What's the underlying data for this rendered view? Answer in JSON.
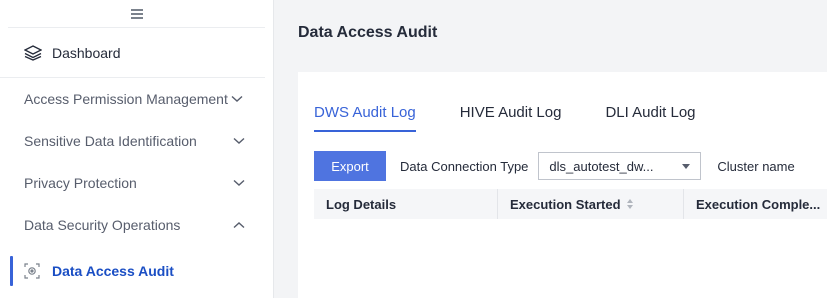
{
  "sidebar": {
    "dashboard_label": "Dashboard",
    "items": [
      {
        "label": "Access Permission Management",
        "chevron": "down"
      },
      {
        "label": "Sensitive Data Identification",
        "chevron": "down"
      },
      {
        "label": "Privacy Protection",
        "chevron": "down"
      },
      {
        "label": "Data Security Operations",
        "chevron": "up"
      }
    ],
    "active_sub_item": "Data Access Audit"
  },
  "main": {
    "title": "Data Access Audit",
    "tabs": [
      {
        "label": "DWS Audit Log",
        "active": true
      },
      {
        "label": "HIVE Audit Log",
        "active": false
      },
      {
        "label": "DLI Audit Log",
        "active": false
      }
    ],
    "toolbar": {
      "export_label": "Export",
      "connection_type_label": "Data Connection Type",
      "connection_type_value": "dls_autotest_dw...",
      "cluster_label": "Cluster name"
    },
    "table": {
      "columns": [
        "Log Details",
        "Execution Started",
        "Execution Comple..."
      ]
    }
  },
  "colors": {
    "accent": "#3863d8",
    "export_button": "#4f74e0",
    "active_text": "#1a4ec4"
  }
}
